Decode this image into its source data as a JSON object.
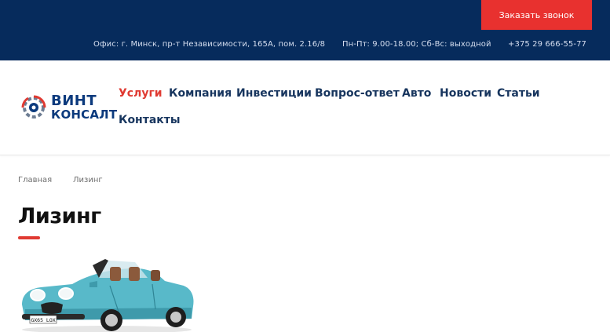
{
  "topbar": {
    "callback_label": "Заказать звонок",
    "address": "Офис: г. Минск, пр-т Независимости, 165А, пом. 2.16/8",
    "hours": "Пн-Пт: 9.00-18.00; Сб-Вс: выходной",
    "phone": "+375 29 666-55-77"
  },
  "logo": {
    "line1": "ВИНТ",
    "line2": "КОНСАЛТ"
  },
  "nav": {
    "items": [
      {
        "label": "Услуги",
        "active": true
      },
      {
        "label": "Компания"
      },
      {
        "label": "Инвестиции"
      },
      {
        "label": "Вопрос-ответ"
      },
      {
        "label": "Авто"
      },
      {
        "label": "Новости"
      },
      {
        "label": "Статьи"
      },
      {
        "label": "Контакты"
      }
    ]
  },
  "breadcrumb": {
    "home": "Главная",
    "current": "Лизинг"
  },
  "page": {
    "title": "Лизинг"
  },
  "colors": {
    "topbar_bg": "#062b5c",
    "accent": "#e8312f",
    "nav_text": "#17355e"
  },
  "car_plate": "GX65 LOX"
}
